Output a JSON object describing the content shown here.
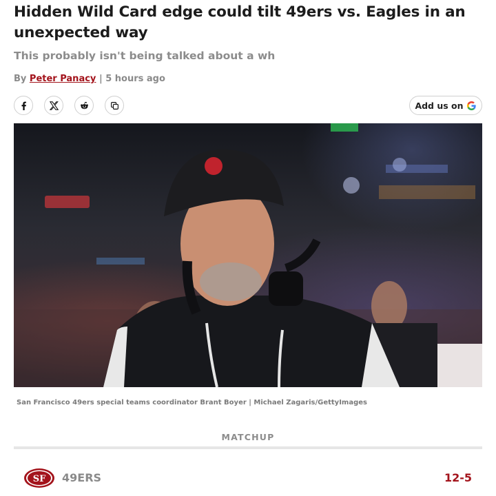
{
  "article": {
    "headline": "Hidden Wild Card edge could tilt 49ers vs. Eagles in an unexpected way",
    "subheadline": "This probably isn't being talked about a wh",
    "byline_prefix": "By",
    "author": "Peter Panacy",
    "separator": "|",
    "timestamp": "5 hours ago"
  },
  "share": {
    "buttons": [
      {
        "icon": "facebook-icon",
        "glyph": "f"
      },
      {
        "icon": "x-icon",
        "glyph": "X"
      },
      {
        "icon": "reddit-icon",
        "glyph": "reddit"
      },
      {
        "icon": "copy-link-icon",
        "glyph": "copy"
      }
    ],
    "add_us_label": "Add us on",
    "add_us_logo": "G"
  },
  "image": {
    "caption": "San Francisco 49ers special teams coordinator Brant Boyer | Michael Zagaris/GettyImages"
  },
  "matchup": {
    "label": "MATCHUP",
    "team": {
      "name": "49ERS",
      "record": "12-5",
      "logo_text": "SF"
    }
  },
  "colors": {
    "brand_red": "#a3131b",
    "muted_gray": "#8c8c8c",
    "border": "#cfcfcf"
  }
}
